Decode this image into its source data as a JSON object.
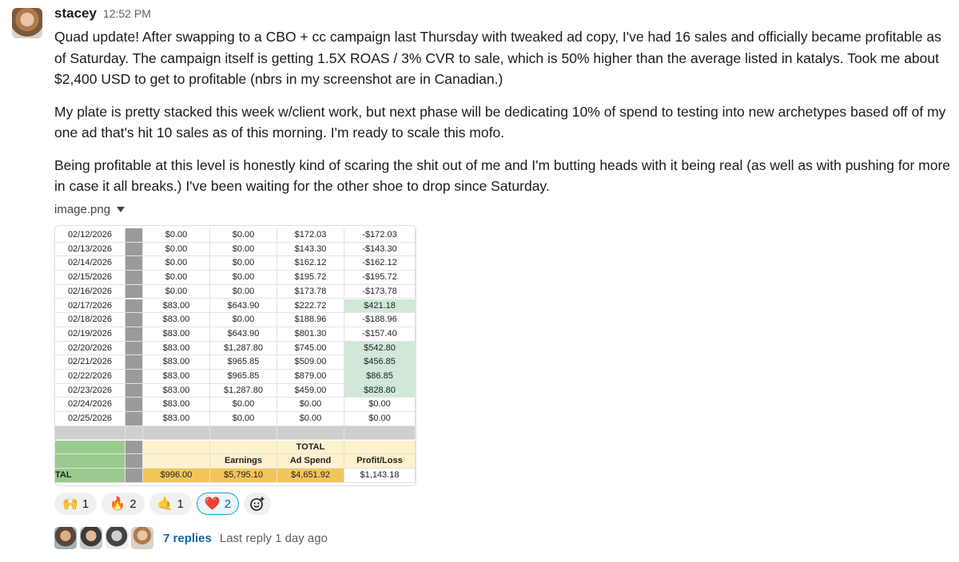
{
  "message": {
    "author": "stacey",
    "time": "12:52 PM",
    "paragraphs": [
      "Quad update! After swapping to a CBO + cc campaign last Thursday with tweaked ad copy, I've had 16 sales and officially became profitable as of Saturday. The campaign itself is getting 1.5X ROAS / 3% CVR to sale, which is 50% higher than the average listed in katalys. Took me about $2,400 USD to get to profitable (nbrs in my screenshot are in Canadian.)",
      "My plate is pretty stacked this week w/client work, but next phase will be dedicating 10% of spend to testing into new archetypes based off of my one ad that's hit 10 sales as of this morning. I'm ready to scale this mofo.",
      "Being profitable at this level is honestly kind of scaring the shit out of me and I'm butting heads with it being real (as well as with pushing for more in case it all breaks.) I've been waiting for the other shoe to drop since Saturday."
    ]
  },
  "attachment": {
    "filename": "image.png",
    "table": {
      "rows": [
        {
          "date": "02/12/2026",
          "a": "$0.00",
          "b": "$0.00",
          "c": "$172.03",
          "d": "-$172.03",
          "pos": false
        },
        {
          "date": "02/13/2026",
          "a": "$0.00",
          "b": "$0.00",
          "c": "$143.30",
          "d": "-$143.30",
          "pos": false
        },
        {
          "date": "02/14/2026",
          "a": "$0.00",
          "b": "$0.00",
          "c": "$162.12",
          "d": "-$162.12",
          "pos": false
        },
        {
          "date": "02/15/2026",
          "a": "$0.00",
          "b": "$0.00",
          "c": "$195.72",
          "d": "-$195.72",
          "pos": false
        },
        {
          "date": "02/16/2026",
          "a": "$0.00",
          "b": "$0.00",
          "c": "$173.78",
          "d": "-$173.78",
          "pos": false
        },
        {
          "date": "02/17/2026",
          "a": "$83.00",
          "b": "$643.90",
          "c": "$222.72",
          "d": "$421.18",
          "pos": true
        },
        {
          "date": "02/18/2026",
          "a": "$83.00",
          "b": "$0.00",
          "c": "$188.96",
          "d": "-$188.96",
          "pos": false
        },
        {
          "date": "02/19/2026",
          "a": "$83.00",
          "b": "$643.90",
          "c": "$801.30",
          "d": "-$157.40",
          "pos": false
        },
        {
          "date": "02/20/2026",
          "a": "$83.00",
          "b": "$1,287.80",
          "c": "$745.00",
          "d": "$542.80",
          "pos": true
        },
        {
          "date": "02/21/2026",
          "a": "$83.00",
          "b": "$965.85",
          "c": "$509.00",
          "d": "$456.85",
          "pos": true
        },
        {
          "date": "02/22/2026",
          "a": "$83.00",
          "b": "$965.85",
          "c": "$879.00",
          "d": "$86.85",
          "pos": true
        },
        {
          "date": "02/23/2026",
          "a": "$83.00",
          "b": "$1,287.80",
          "c": "$459.00",
          "d": "$828.80",
          "pos": true
        },
        {
          "date": "02/24/2026",
          "a": "$83.00",
          "b": "$0.00",
          "c": "$0.00",
          "d": "$0.00",
          "pos": false
        },
        {
          "date": "02/25/2026",
          "a": "$83.00",
          "b": "$0.00",
          "c": "$0.00",
          "d": "$0.00",
          "pos": false
        }
      ],
      "total_heading": "TOTAL",
      "headers": {
        "earnings": "Earnings",
        "ad_spend": "Ad Spend",
        "profit_loss": "Profit/Loss"
      },
      "totals": {
        "label": "TAL",
        "a": "$996.00",
        "b": "$5,795.10",
        "c": "$4,651.92",
        "d": "$1,143.18"
      }
    }
  },
  "reactions": [
    {
      "emoji": "🙌",
      "count": "1",
      "icon": "raised-hands-icon",
      "active": false
    },
    {
      "emoji": "🔥",
      "count": "2",
      "icon": "fire-icon",
      "active": false
    },
    {
      "emoji": "🤙",
      "count": "1",
      "icon": "call-me-hand-icon",
      "active": false
    },
    {
      "emoji": "❤️",
      "count": "2",
      "icon": "heart-icon",
      "active": true
    }
  ],
  "add_reaction_icon": "add-reaction-icon",
  "thread": {
    "replies": "7 replies",
    "last_reply": "Last reply 1 day ago"
  }
}
